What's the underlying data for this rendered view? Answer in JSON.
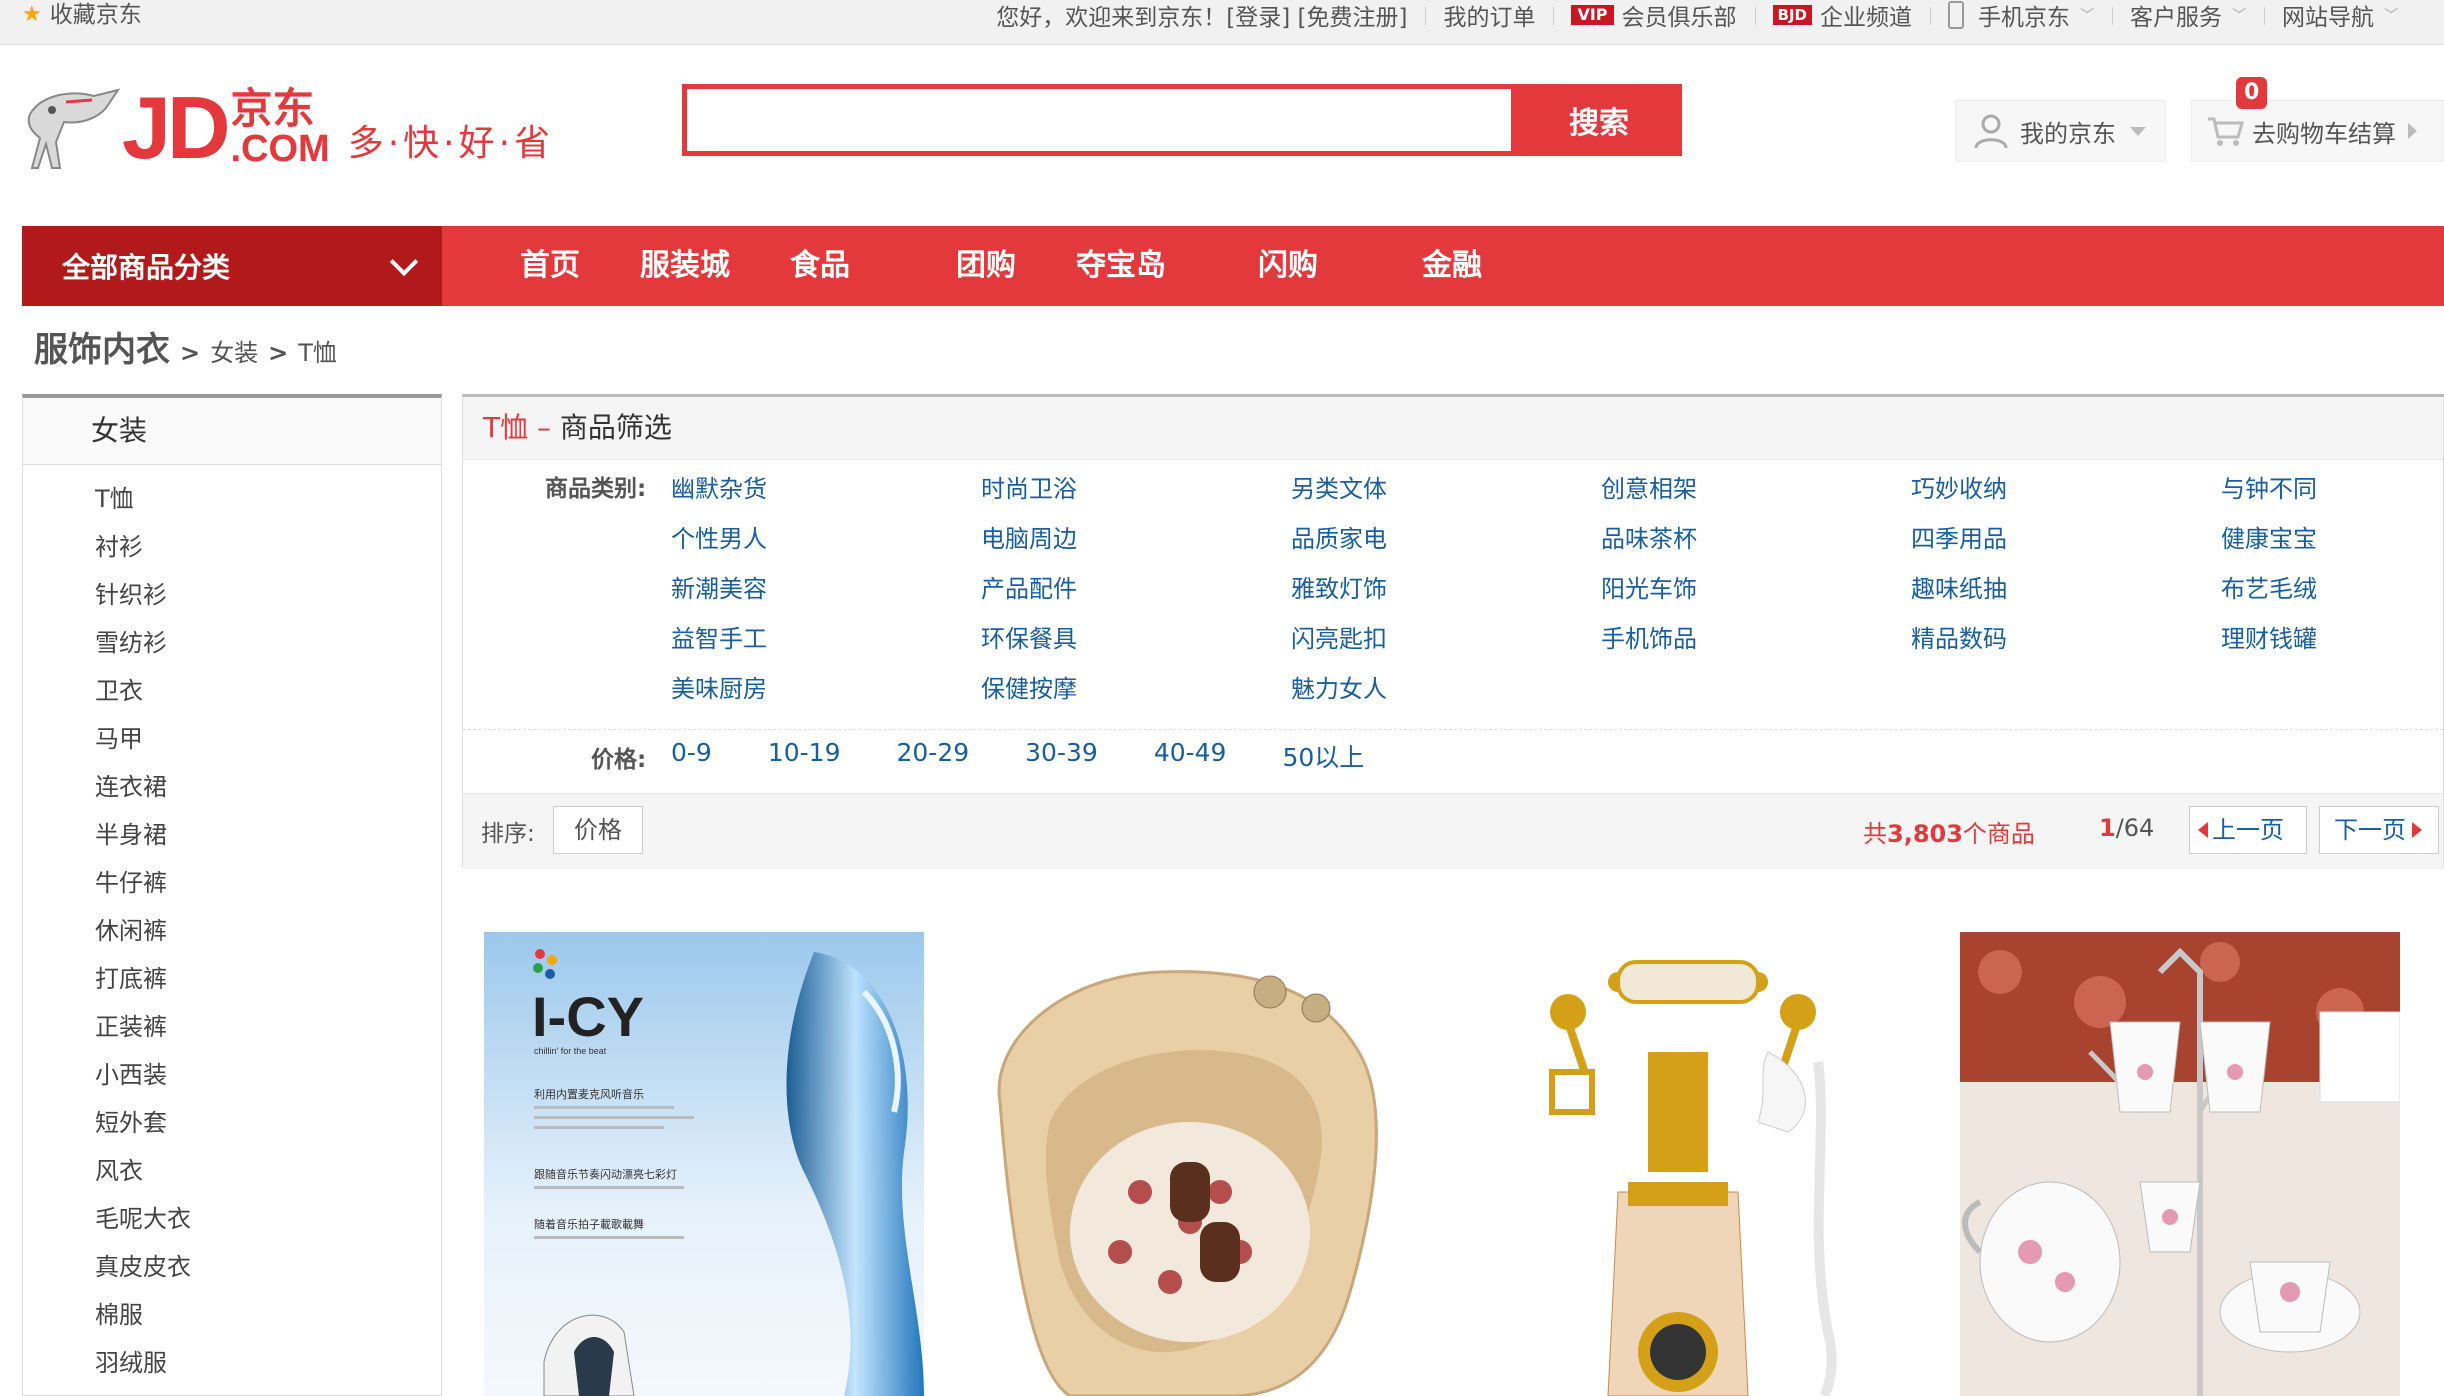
{
  "topbar": {
    "favorite": "收藏京东",
    "welcome": "您好，欢迎来到京东！[登录] [免费注册]",
    "my_orders": "我的订单",
    "vip_badge": "VIP",
    "vip_club": "会员俱乐部",
    "bjd_badge": "BJD",
    "enterprise": "企业频道",
    "mobile": "手机京东",
    "service": "客户服务",
    "site_nav": "网站导航"
  },
  "logo": {
    "jd": "JD",
    "cn_top": "京东",
    "cn_bottom": ".COM",
    "slogan": "多·快·好·省"
  },
  "search": {
    "value": "",
    "placeholder": "",
    "button": "搜索"
  },
  "header": {
    "my_jd": "我的京东",
    "cart_count": "0",
    "cart": "去购物车结算"
  },
  "nav": {
    "all_categories": "全部商品分类",
    "items": [
      "首页",
      "服装城",
      "食品",
      "团购",
      "夺宝岛",
      "闪购",
      "金融"
    ]
  },
  "breadcrumb": {
    "root": "服饰内衣",
    "level1": "女装",
    "level2": "T恤"
  },
  "sidebar": {
    "title": "女装",
    "items": [
      "T恤",
      "衬衫",
      "针织衫",
      "雪纺衫",
      "卫衣",
      "马甲",
      "连衣裙",
      "半身裙",
      "牛仔裤",
      "休闲裤",
      "打底裤",
      "正装裤",
      "小西装",
      "短外套",
      "风衣",
      "毛呢大衣",
      "真皮皮衣",
      "棉服",
      "羽绒服"
    ]
  },
  "filter": {
    "title_red": "T恤",
    "title_dash": " – ",
    "title_rest": "商品筛选",
    "category_label": "商品类别:",
    "categories": [
      "幽默杂货",
      "时尚卫浴",
      "另类文体",
      "创意相架",
      "巧妙收纳",
      "与钟不同",
      "个性男人",
      "电脑周边",
      "品质家电",
      "品味茶杯",
      "四季用品",
      "健康宝宝",
      "新潮美容",
      "产品配件",
      "雅致灯饰",
      "阳光车饰",
      "趣味纸抽",
      "布艺毛绒",
      "益智手工",
      "环保餐具",
      "闪亮匙扣",
      "手机饰品",
      "精品数码",
      "理财钱罐",
      "美味厨房",
      "保健按摩",
      "魅力女人"
    ],
    "price_label": "价格:",
    "prices": [
      "0-9",
      "10-19",
      "20-29",
      "30-39",
      "40-49",
      "50以上"
    ],
    "sort_label": "排序:",
    "sort_price": "价格",
    "count_prefix": "共",
    "count_value": "3,803",
    "count_suffix": "个商品",
    "page_current": "1",
    "page_total": "/64",
    "prev": "上一页",
    "next": "下一页"
  },
  "products": [
    {
      "brand_text": "I-CY",
      "subtitle": "chillin' for the beat",
      "desc1": "利用内置麦克风听音乐",
      "desc2": "跟随音乐节奏闪动漂亮七彩灯",
      "desc3": "随着音乐拍子載歌載舞"
    },
    {
      "kind": "foot-spa"
    },
    {
      "kind": "telephone"
    },
    {
      "kind": "tea-set"
    }
  ],
  "colors": {
    "brand_red": "#e4393c",
    "nav_dark": "#b1191a",
    "link_blue": "#1a5ea0"
  }
}
